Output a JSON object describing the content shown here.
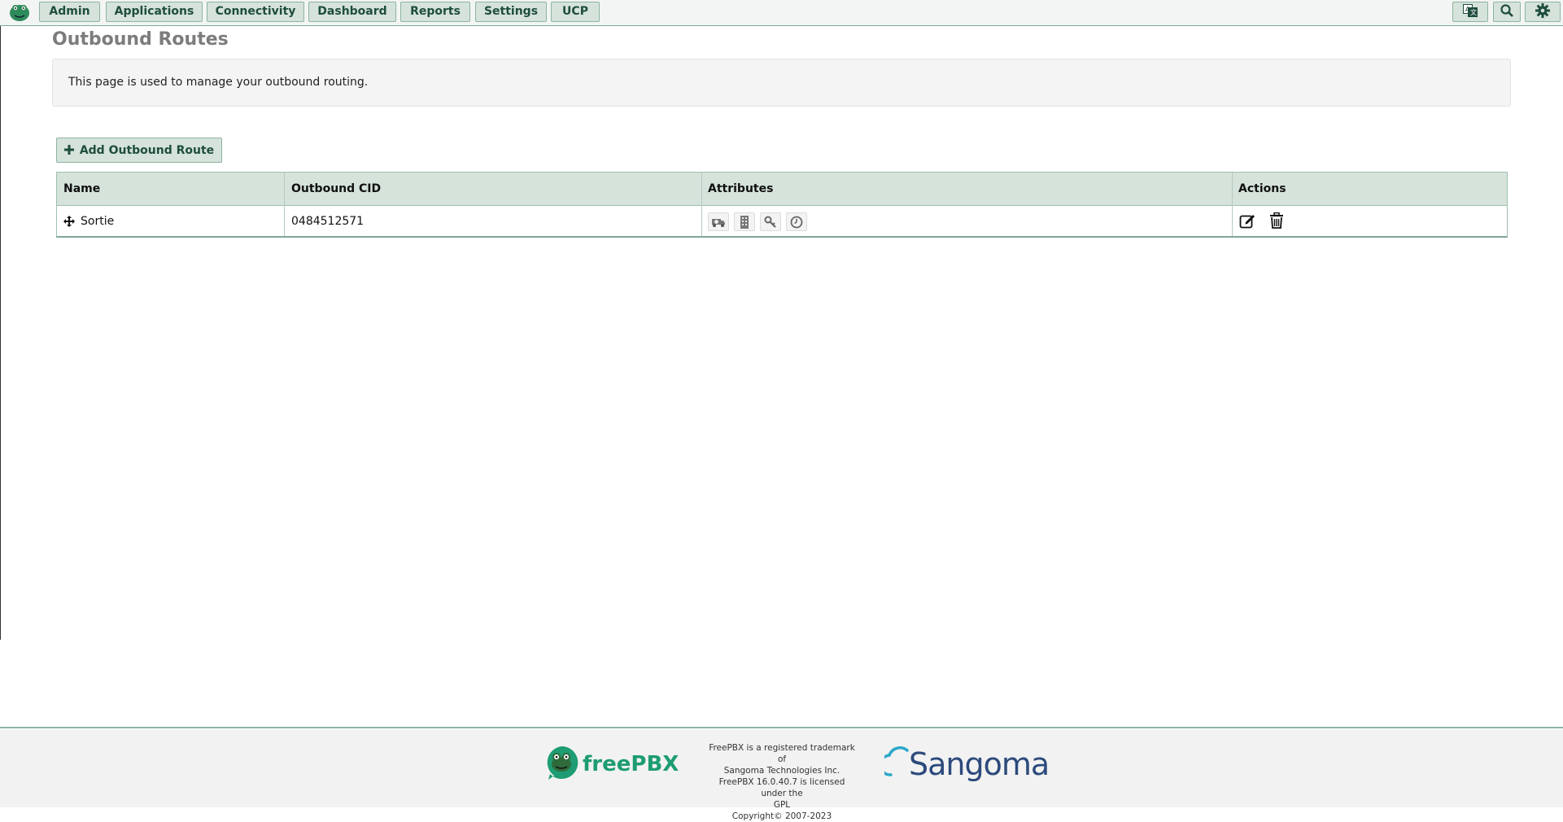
{
  "nav": {
    "items": [
      {
        "label": "Admin"
      },
      {
        "label": "Applications"
      },
      {
        "label": "Connectivity"
      },
      {
        "label": "Dashboard"
      },
      {
        "label": "Reports"
      },
      {
        "label": "Settings"
      },
      {
        "label": "UCP"
      }
    ],
    "icons": [
      "translate-icon",
      "search-icon",
      "gear-icon"
    ]
  },
  "page": {
    "title": "Outbound Routes",
    "description": "This page is used to manage your outbound routing.",
    "add_button_label": "Add Outbound Route"
  },
  "table": {
    "columns": [
      "Name",
      "Outbound CID",
      "Attributes",
      "Actions"
    ],
    "rows": [
      {
        "name": "Sortie",
        "outbound_cid": "0484512571",
        "attributes": [
          "ambulance-icon",
          "building-icon",
          "key-icon",
          "clock-icon"
        ],
        "actions": [
          "edit-icon",
          "trash-icon"
        ]
      }
    ]
  },
  "footer": {
    "brand": "freePBX",
    "legal_lines": [
      "FreePBX is a registered trademark of",
      "Sangoma Technologies Inc.",
      "FreePBX 16.0.40.7 is licensed under the",
      "GPL",
      "Copyright© 2007-2023"
    ],
    "partner": "Sangoma"
  },
  "colors": {
    "accent": "#d5e3db",
    "accent_text": "#1f4d3e",
    "border": "#8fb3a3",
    "brand_green": "#1e9c73",
    "sangoma_blue": "#2c4a7c"
  }
}
